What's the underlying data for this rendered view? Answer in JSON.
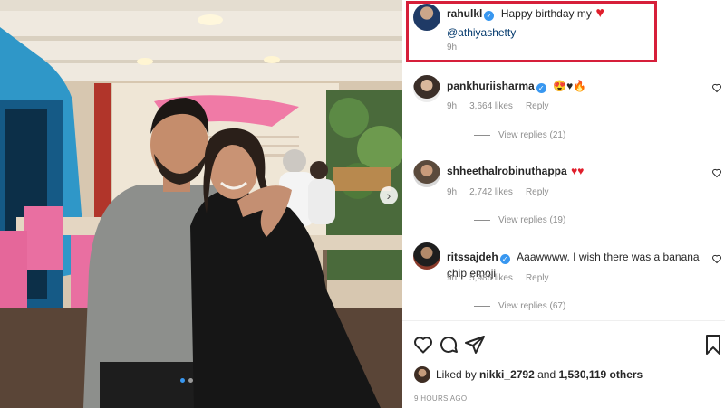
{
  "post": {
    "image_nav": {
      "next_glyph": "›",
      "dots_total": 2,
      "dot_active": 1
    }
  },
  "caption": {
    "username": "rahulkl",
    "text": "Happy birthday my",
    "heart": "♥",
    "mention": "@athiyashetty",
    "time": "9h"
  },
  "comments": [
    {
      "username": "pankhuriisharma",
      "verified": true,
      "text": "😍♥🔥",
      "time": "9h",
      "likes": "3,664 likes",
      "reply": "Reply",
      "view_replies": "View replies (21)"
    },
    {
      "username": "shheethalrobinuthappa",
      "verified": false,
      "text": "♥♥",
      "time": "9h",
      "likes": "2,742 likes",
      "reply": "Reply",
      "view_replies": "View replies (19)"
    },
    {
      "username": "ritssajdeh",
      "verified": true,
      "text": "Aaawwww. I wish there was a banana chip emoji",
      "time": "9h",
      "likes": "5,986 likes",
      "reply": "Reply",
      "view_replies": "View replies (67)"
    }
  ],
  "verified_glyph": "✓",
  "liked_by": {
    "prefix": "Liked by",
    "user": "nikki_2792",
    "and": "and",
    "count": "1,530,119 others"
  },
  "timestamp": "9 HOURS AGO",
  "icons": [
    "heart-outline-icon",
    "comment-bubble-icon",
    "share-plane-icon",
    "bookmark-icon"
  ],
  "colors": {
    "highlight_border": "#d61f3a",
    "verified": "#3897f0",
    "heart": "#e01e2b",
    "mention": "#00376b",
    "muted": "#8e8e8e"
  }
}
